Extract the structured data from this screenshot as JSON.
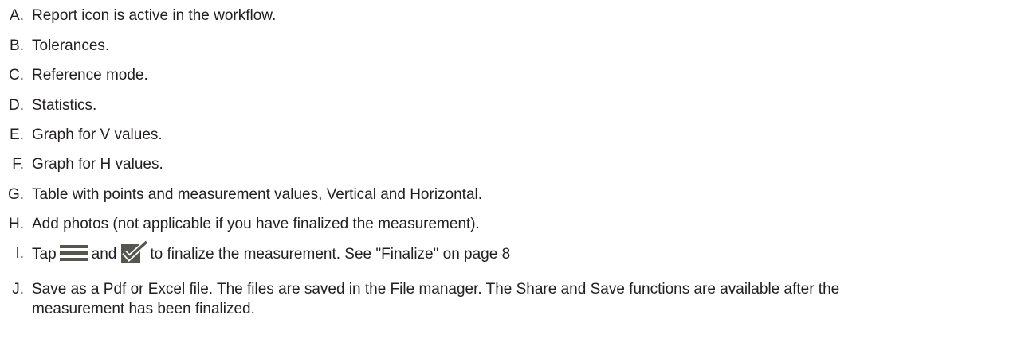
{
  "items": [
    {
      "letter": "A.",
      "text": "Report icon is active in the workflow."
    },
    {
      "letter": "B.",
      "text": "Tolerances."
    },
    {
      "letter": "C.",
      "text": "Reference mode."
    },
    {
      "letter": "D.",
      "text": "Statistics."
    },
    {
      "letter": "E.",
      "text": "Graph for V values."
    },
    {
      "letter": "F.",
      "text": "Graph for H values."
    },
    {
      "letter": "G.",
      "text": "Table with points and measurement values, Vertical and Horizontal."
    },
    {
      "letter": "H.",
      "text": "Add photos (not applicable if you have finalized the measurement)."
    },
    {
      "letter": "I.",
      "text_before": "Tap",
      "text_middle": "and",
      "text_after": "to finalize the measurement. See \"Finalize\" on page 8"
    },
    {
      "letter": "J.",
      "text": "Save as a Pdf or Excel file. The files are saved in the File manager. The Share and Save functions are available after the measurement has been finalized."
    }
  ],
  "icons": {
    "menu": "menu-icon",
    "finalize": "check-icon",
    "color": "#55564e"
  }
}
